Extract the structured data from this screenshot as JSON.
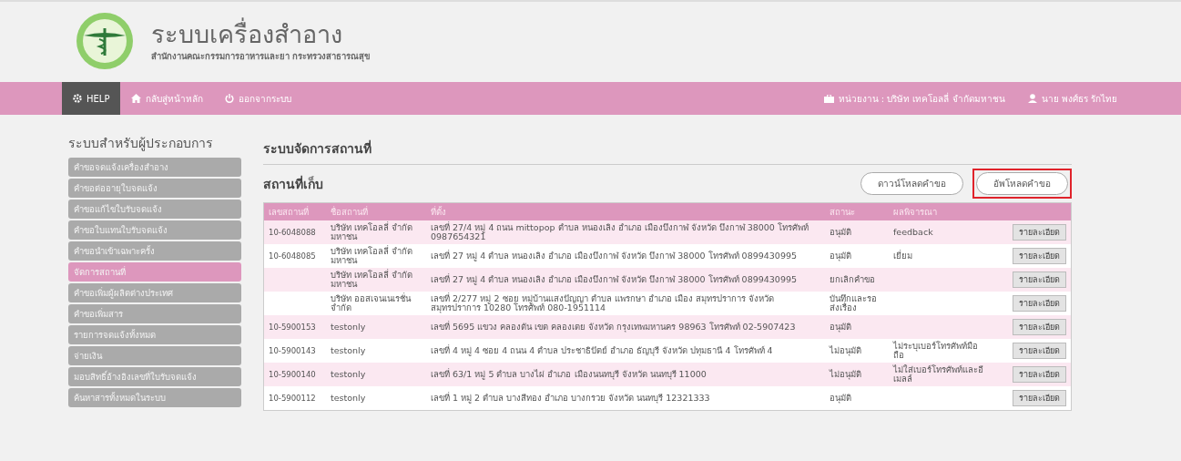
{
  "header": {
    "title": "ระบบเครื่องสำอาง",
    "subtitle": "สำนักงานคณะกรรมการอาหารและยา กระทรวงสาธารณสุข"
  },
  "navbar": {
    "items": [
      {
        "label": "HELP",
        "kind": "help",
        "selected": true
      },
      {
        "label": "กลับสู่หน้าหลัก",
        "kind": "home",
        "selected": false
      },
      {
        "label": "ออกจากระบบ",
        "kind": "logout",
        "selected": false
      }
    ],
    "agency": "หน่วยงาน : บริษัท เทคโอลลี่ จำกัดมหาชน",
    "user": "นาย พงศ์ธร รักไทย"
  },
  "sidebar": {
    "title": "ระบบสำหรับผู้ประกอบการ",
    "items": [
      {
        "label": "คำขอจดแจ้งเครื่องสำอาง",
        "selected": false
      },
      {
        "label": "คำขอต่ออายุใบจดแจ้ง",
        "selected": false
      },
      {
        "label": "คำขอแก้ไขใบรับจดแจ้ง",
        "selected": false
      },
      {
        "label": "คำขอใบแทนใบรับจดแจ้ง",
        "selected": false
      },
      {
        "label": "คำขอนำเข้าเฉพาะครั้ง",
        "selected": false
      },
      {
        "label": "จัดการสถานที่",
        "selected": true
      },
      {
        "label": "คำขอเพิ่มผู้ผลิตต่างประเทศ",
        "selected": false
      },
      {
        "label": "คำขอเพิ่มสาร",
        "selected": false
      },
      {
        "label": "รายการจดแจ้งทั้งหมด",
        "selected": false
      },
      {
        "label": "จ่ายเงิน",
        "selected": false
      },
      {
        "label": "มอบสิทธิ์อ้างอิงเลขที่ใบรับจดแจ้ง",
        "selected": false
      },
      {
        "label": "ค้นหาสารทั้งหมดในระบบ",
        "selected": false
      }
    ]
  },
  "main": {
    "title": "ระบบจัดการสถานที่",
    "section": "สถานที่เก็บ",
    "buttons": [
      {
        "label": "ดาวน์โหลดคำขอ",
        "highlighted": false
      },
      {
        "label": "อัพโหลดคำขอ",
        "highlighted": true
      }
    ],
    "table": {
      "columns": [
        "เลขสถานที่",
        "ชื่อสถานที่",
        "ที่ตั้ง",
        "สถานะ",
        "ผลพิจารณา"
      ],
      "rows": [
        {
          "number": "10-6048088",
          "name": "บริษัท เทคโอลลี่ จำกัดมหาชน",
          "address": "เลขที่ 27/4 หมู่ 4 ถนน mittopop ตำบล หนองเลิง อำเภอ เมืองบึงกาฬ จังหวัด บึงกาฬ 38000 โทรศัพท์ 0987654321",
          "status": "อนุมัติ",
          "result": "feedback",
          "action": "รายละเอียด"
        },
        {
          "number": "10-6048085",
          "name": "บริษัท เทคโอลลี่ จำกัดมหาชน",
          "address": "เลขที่ 27 หมู่ 4 ตำบล หนองเลิง อำเภอ เมืองบึงกาฬ จังหวัด บึงกาฬ 38000 โทรศัพท์ 0899430995",
          "status": "อนุมัติ",
          "result": "เยี่ยม",
          "action": "รายละเอียด"
        },
        {
          "name": "บริษัท เทคโอลลี่ จำกัดมหาชน",
          "address": "เลขที่ 27 หมู่ 4 ตำบล หนองเลิง อำเภอ เมืองบึงกาฬ จังหวัด บึงกาฬ 38000 โทรศัพท์ 0899430995",
          "status": "ยกเลิกคำขอ",
          "action": "รายละเอียด"
        },
        {
          "name": "บริษัท ออสเจนเนเรชั่น จำกัด",
          "address": "เลขที่ 2/277 หมู่ 2 ซอย หมู่บ้านแสงปัญญา ตำบล แพรกษา อำเภอ เมือง สมุทรปราการ จังหวัด สมุทรปราการ 10280 โทรศัพท์ 080-1951114",
          "status": "บันทึกและรอส่งเรื่อง",
          "action": "รายละเอียด"
        },
        {
          "number": "10-5900153",
          "name": "testonly",
          "address": "เลขที่ 5695 แขวง คลองตัน เขต คลองเตย จังหวัด กรุงเทพมหานคร 98963 โทรศัพท์ 02-5907423",
          "status": "อนุมัติ",
          "action": "รายละเอียด"
        },
        {
          "number": "10-5900143",
          "name": "testonly",
          "address": "เลขที่ 4 หมู่ 4 ซอย 4 ถนน 4 ตำบล ประชาธิปัตย์ อำเภอ ธัญบุรี จังหวัด ปทุมธานี 4 โทรศัพท์ 4",
          "status": "ไม่อนุมัติ",
          "result": "ไม่ระบุเบอร์โทรศัพท์มือถือ",
          "action": "รายละเอียด"
        },
        {
          "number": "10-5900140",
          "name": "testonly",
          "address": "เลขที่ 63/1 หมู่ 5 ตำบล บางไผ่ อำเภอ เมืองนนทบุรี จังหวัด นนทบุรี 11000",
          "status": "ไม่อนุมัติ",
          "result": "ไม่ใส่เบอร์โทรศัพท์และอีเมลล์",
          "action": "รายละเอียด"
        },
        {
          "number": "10-5900112",
          "name": "testonly",
          "address": "เลขที่ 1 หมู่ 2 ตำบล บางสีทอง อำเภอ บางกรวย จังหวัด นนทบุรี 12321333",
          "status": "อนุมัติ",
          "action": "รายละเอียด"
        }
      ]
    }
  }
}
